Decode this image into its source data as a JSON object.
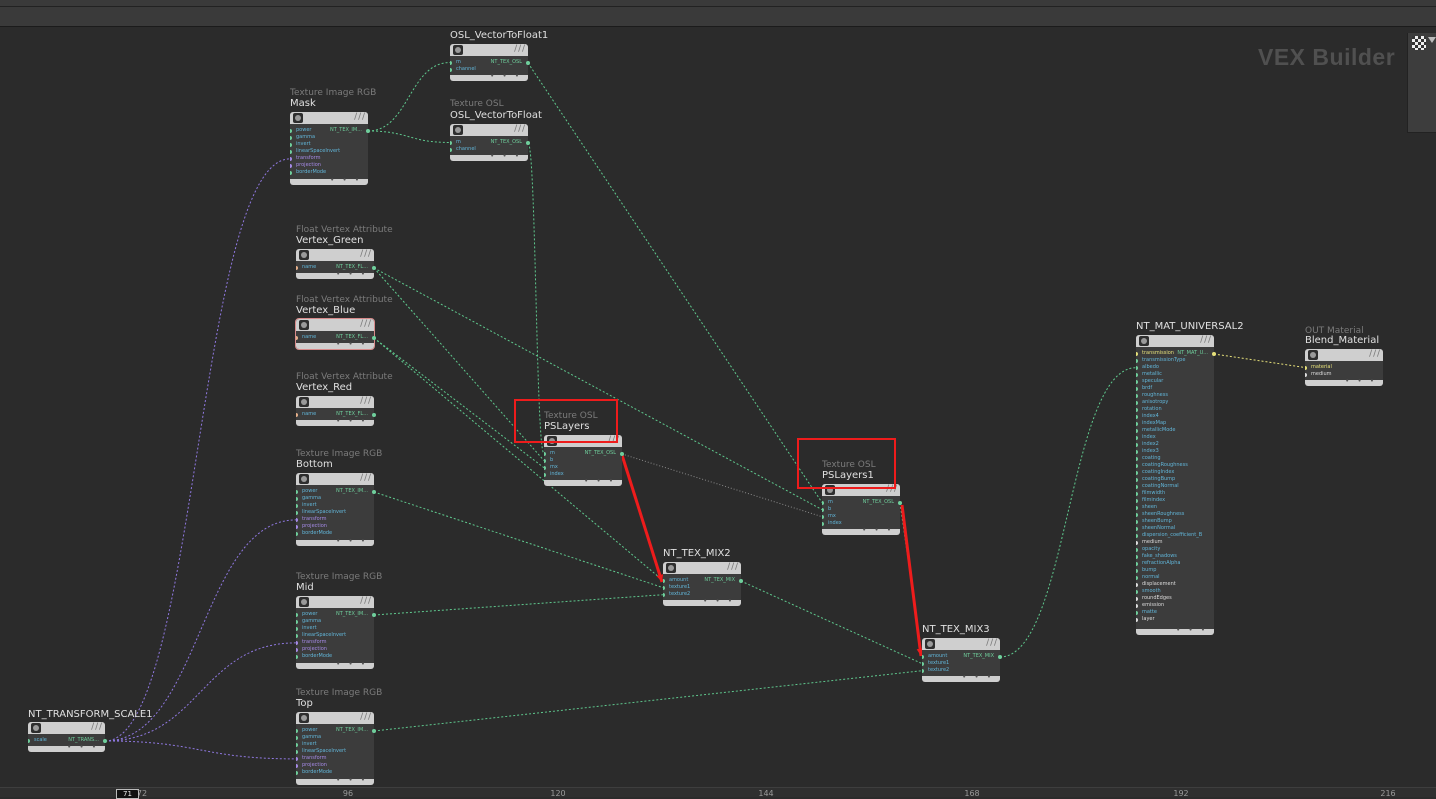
{
  "network": {
    "watermark": "VEX Builder"
  },
  "nodes": [
    {
      "id": "vtf1",
      "type": "",
      "name": "OSL_VectorToFloat1",
      "inputs": [
        [
          "m",
          "green"
        ],
        [
          "channel",
          "blue"
        ]
      ],
      "output": "NT_TEX_OSL"
    },
    {
      "id": "vtf",
      "type": "Texture OSL",
      "name": "OSL_VectorToFloat",
      "inputs": [
        [
          "m",
          "green"
        ],
        [
          "channel",
          "blue"
        ]
      ],
      "output": "NT_TEX_OSL"
    },
    {
      "id": "mask",
      "type": "Texture Image RGB",
      "name": "Mask",
      "inputs": [
        [
          "power",
          "green"
        ],
        [
          "gamma",
          "green"
        ],
        [
          "invert",
          "blue"
        ],
        [
          "linearSpaceInvert",
          "blue"
        ],
        [
          "transform",
          "purple"
        ],
        [
          "projection",
          "purple"
        ],
        [
          "borderMode",
          "blue"
        ]
      ],
      "output": "NT_TEX_IM..."
    },
    {
      "id": "vgreen",
      "type": "Float Vertex Attribute",
      "name": "Vertex_Green",
      "inputs": [
        [
          "name",
          "orange"
        ]
      ],
      "output": "NT_TEX_FL..."
    },
    {
      "id": "vblue",
      "type": "Float Vertex Attribute",
      "name": "Vertex_Blue",
      "inputs": [
        [
          "name",
          "orange"
        ]
      ],
      "output": "NT_TEX_FL..."
    },
    {
      "id": "vred",
      "type": "Float Vertex Attribute",
      "name": "Vertex_Red",
      "inputs": [
        [
          "name",
          "orange"
        ]
      ],
      "output": "NT_TEX_FL..."
    },
    {
      "id": "bottom",
      "type": "Texture Image RGB",
      "name": "Bottom",
      "inputs": [
        [
          "power",
          "green"
        ],
        [
          "gamma",
          "green"
        ],
        [
          "invert",
          "blue"
        ],
        [
          "linearSpaceInvert",
          "blue"
        ],
        [
          "transform",
          "purple"
        ],
        [
          "projection",
          "purple"
        ],
        [
          "borderMode",
          "blue"
        ]
      ],
      "output": "NT_TEX_IM..."
    },
    {
      "id": "mid",
      "type": "Texture Image RGB",
      "name": "Mid",
      "inputs": [
        [
          "power",
          "green"
        ],
        [
          "gamma",
          "green"
        ],
        [
          "invert",
          "blue"
        ],
        [
          "linearSpaceInvert",
          "blue"
        ],
        [
          "transform",
          "purple"
        ],
        [
          "projection",
          "purple"
        ],
        [
          "borderMode",
          "blue"
        ]
      ],
      "output": "NT_TEX_IM..."
    },
    {
      "id": "top",
      "type": "Texture Image RGB",
      "name": "Top",
      "inputs": [
        [
          "power",
          "green"
        ],
        [
          "gamma",
          "green"
        ],
        [
          "invert",
          "blue"
        ],
        [
          "linearSpaceInvert",
          "blue"
        ],
        [
          "transform",
          "purple"
        ],
        [
          "projection",
          "purple"
        ],
        [
          "borderMode",
          "blue"
        ]
      ],
      "output": "NT_TEX_IM..."
    },
    {
      "id": "xform",
      "type": "",
      "name": "NT_TRANSFORM_SCALE1",
      "inputs": [
        [
          "scale",
          "green"
        ]
      ],
      "output": "NT_TRANS..."
    },
    {
      "id": "ps",
      "type": "Texture OSL",
      "name": "PSLayers",
      "inputs": [
        [
          "m",
          "green"
        ],
        [
          "b",
          "green"
        ],
        [
          "mx",
          "green"
        ],
        [
          "index",
          "blue"
        ]
      ],
      "output": "NT_TEX_OSL"
    },
    {
      "id": "mix2",
      "type": "",
      "name": "NT_TEX_MIX2",
      "inputs": [
        [
          "amount",
          "green"
        ],
        [
          "texture1",
          "green"
        ],
        [
          "texture2",
          "green"
        ]
      ],
      "output": "NT_TEX_MIX"
    },
    {
      "id": "ps1",
      "type": "Texture OSL",
      "name": "PSLayers1",
      "inputs": [
        [
          "m",
          "green"
        ],
        [
          "b",
          "green"
        ],
        [
          "mx",
          "green"
        ],
        [
          "index",
          "blue"
        ]
      ],
      "output": "NT_TEX_OSL"
    },
    {
      "id": "mix3",
      "type": "",
      "name": "NT_TEX_MIX3",
      "inputs": [
        [
          "amount",
          "green"
        ],
        [
          "texture1",
          "green"
        ],
        [
          "texture2",
          "green"
        ]
      ],
      "output": "NT_TEX_MIX"
    },
    {
      "id": "univ",
      "type": "",
      "name": "NT_MAT_UNIVERSAL2",
      "inputs": [
        [
          "transmission",
          "yellow"
        ],
        [
          "transmissionType",
          "blue"
        ],
        [
          "albedo",
          "green"
        ],
        [
          "metallic",
          "green"
        ],
        [
          "specular",
          "green"
        ],
        [
          "brdf",
          "blue"
        ],
        [
          "roughness",
          "green"
        ],
        [
          "anisotropy",
          "green"
        ],
        [
          "rotation",
          "green"
        ],
        [
          "index4",
          "green"
        ],
        [
          "indexMap",
          "green"
        ],
        [
          "metallicMode",
          "blue"
        ],
        [
          "index",
          "green"
        ],
        [
          "index2",
          "green"
        ],
        [
          "index3",
          "green"
        ],
        [
          "coating",
          "green"
        ],
        [
          "coatingRoughness",
          "green"
        ],
        [
          "coatingIndex",
          "green"
        ],
        [
          "coatingBump",
          "green"
        ],
        [
          "coatingNormal",
          "green"
        ],
        [
          "filmwidth",
          "green"
        ],
        [
          "filmindex",
          "green"
        ],
        [
          "sheen",
          "green"
        ],
        [
          "sheenRoughness",
          "green"
        ],
        [
          "sheenBump",
          "green"
        ],
        [
          "sheenNormal",
          "green"
        ],
        [
          "dispersion_coefficient_B",
          "green"
        ],
        [
          "medium",
          "white"
        ],
        [
          "opacity",
          "green"
        ],
        [
          "fake_shadows",
          "blue"
        ],
        [
          "refractionAlpha",
          "blue"
        ],
        [
          "bump",
          "green"
        ],
        [
          "normal",
          "green"
        ],
        [
          "displacement",
          "white"
        ],
        [
          "smooth",
          "blue"
        ],
        [
          "roundEdges",
          "white"
        ],
        [
          "emission",
          "white"
        ],
        [
          "matte",
          "blue"
        ],
        [
          "layer",
          "white"
        ]
      ],
      "output": "NT_MAT_U..."
    },
    {
      "id": "out",
      "type": "OUT Material",
      "name": "Blend_Material",
      "inputs": [
        [
          "material",
          "yellow"
        ],
        [
          "medium",
          "white"
        ]
      ],
      "output": ""
    }
  ],
  "timeline": {
    "current": "71",
    "ticks": [
      "72",
      "96",
      "120",
      "144",
      "168",
      "192",
      "216"
    ]
  }
}
